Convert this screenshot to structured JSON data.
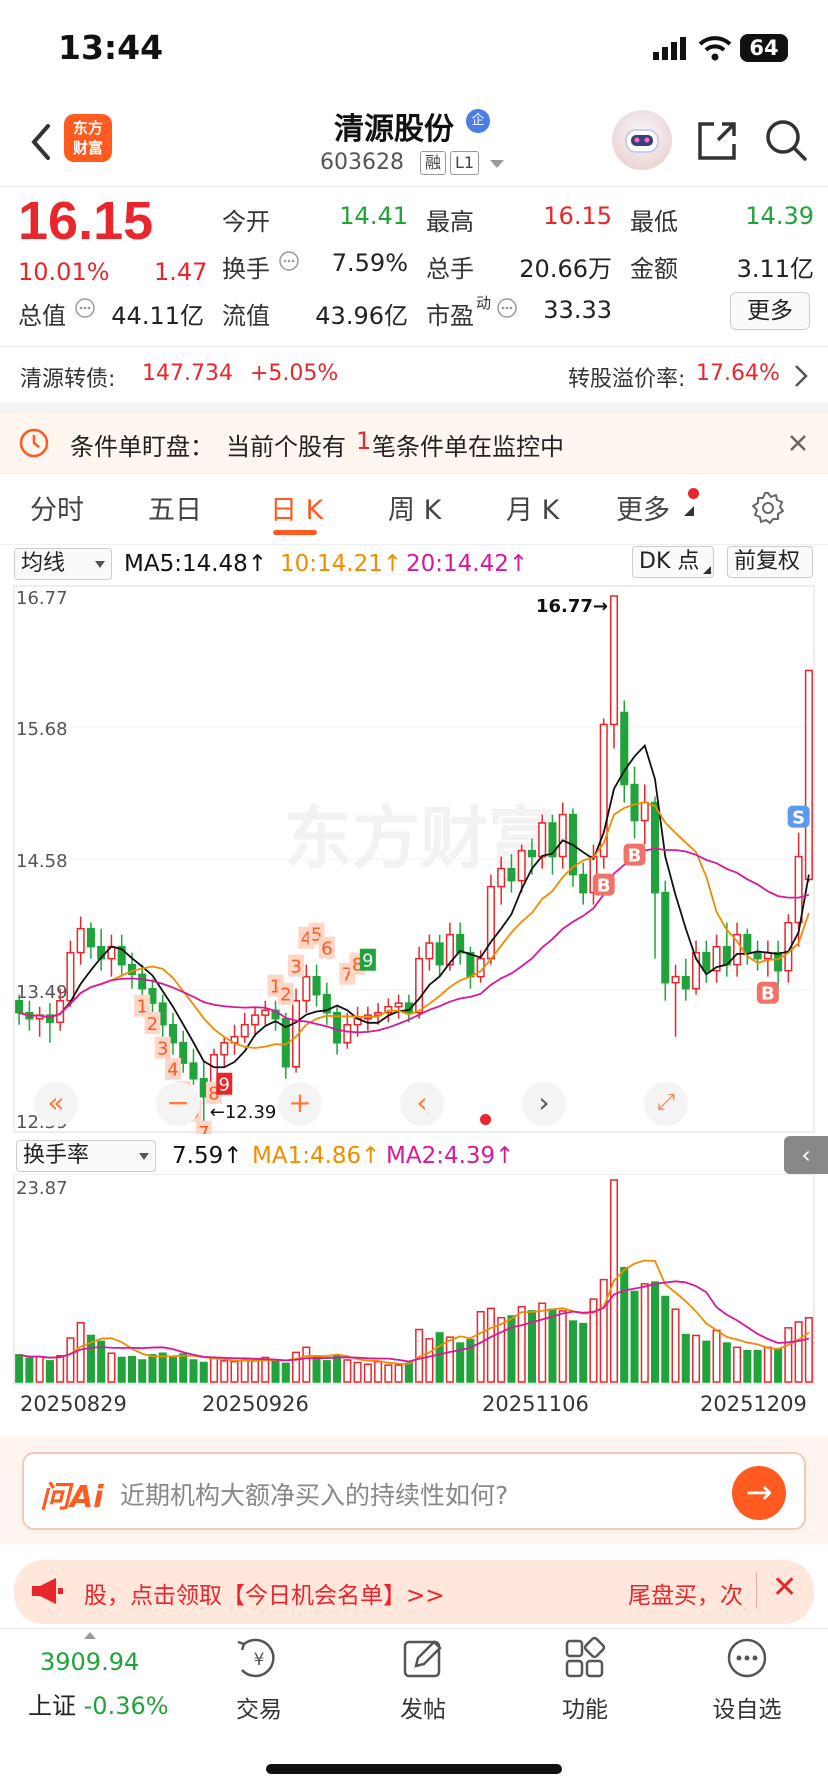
{
  "status_bar": {
    "time": "13:44",
    "battery": "64"
  },
  "header": {
    "logo": "东方\n财富",
    "stock_name": "清源股份",
    "badge": "企",
    "code": "603628",
    "tag1": "融",
    "tag2": "L1"
  },
  "quote": {
    "price": "16.15",
    "pct": "10.01%",
    "change": "1.47",
    "rows": [
      [
        {
          "label": "今开",
          "value": "14.41",
          "color": "green"
        },
        {
          "label": "最高",
          "value": "16.15",
          "color": "red"
        },
        {
          "label": "最低",
          "value": "14.39",
          "color": "green"
        }
      ],
      [
        {
          "label": "换手",
          "value": "7.59%",
          "color": "normal"
        },
        {
          "label": "总手",
          "value": "20.66万",
          "color": "normal"
        },
        {
          "label": "金额",
          "value": "3.11亿",
          "color": "normal"
        }
      ],
      [
        {
          "label": "总值",
          "value": "44.11亿",
          "color": "normal"
        },
        {
          "label": "流值",
          "value": "43.96亿",
          "color": "normal"
        },
        {
          "label": "市盈",
          "sup": "动",
          "value": "33.33",
          "color": "normal"
        }
      ]
    ],
    "more": "更多"
  },
  "convertible": {
    "label": "清源转债:",
    "price": "147.734",
    "pct": "+5.05%",
    "premium_label": "转股溢价率:",
    "premium": "17.64%"
  },
  "alert": {
    "prefix": "条件单盯盘：",
    "text_a": "当前个股有",
    "count": "1",
    "text_b": "笔条件单在监控中"
  },
  "tabs": [
    "分时",
    "五日",
    "日 K",
    "周 K",
    "月 K",
    "更多"
  ],
  "ma_bar": {
    "select": "均线",
    "ma5": "MA5:14.48",
    "ma10": "10:14.21",
    "ma20": "20:14.42",
    "dk": "DK 点",
    "fq": "前复权"
  },
  "kline": {
    "y_labels": [
      "16.77",
      "15.68",
      "14.58",
      "13.49",
      "12.39"
    ],
    "high_mark": "16.77",
    "low_mark": "12.39",
    "watermark": "东方财富",
    "seq_down": [
      "1",
      "2",
      "3",
      "4",
      "5",
      "6",
      "7",
      "8",
      "9"
    ],
    "seq_up": [
      "1",
      "2",
      "3",
      "4",
      "5",
      "6",
      "7",
      "8",
      "9"
    ],
    "b_mark": "B",
    "s_mark": "S"
  },
  "turnover": {
    "select": "换手率",
    "value": "7.59",
    "ma1": "MA1:4.86",
    "ma2": "MA2:4.39",
    "y_max": "23.87"
  },
  "dates": [
    "20250829",
    "20250926",
    "20251106",
    "20251209"
  ],
  "ai": {
    "logo": "问Ai",
    "question": "近期机构大额净买入的持续性如何?"
  },
  "promo": {
    "text": "股，点击领取【今日机会名单】>>",
    "right": "尾盘买，次"
  },
  "index": {
    "value": "3909.94",
    "name": "上证",
    "pct": "-0.36%"
  },
  "nav": [
    "交易",
    "发帖",
    "功能",
    "设自选"
  ],
  "colors": {
    "up": "#e8262c",
    "down": "#21a33c",
    "brand": "#ff5a1f",
    "ma5": "#111111",
    "ma10": "#f08c00",
    "ma20": "#d6199b"
  },
  "chart_data": {
    "type": "candlestick",
    "y_range": [
      12.39,
      16.77
    ],
    "candles": [
      [
        13.4,
        13.3,
        13.45,
        13.2
      ],
      [
        13.3,
        13.25,
        13.4,
        13.15
      ],
      [
        13.25,
        13.28,
        13.35,
        13.1
      ],
      [
        13.28,
        13.22,
        13.38,
        13.05
      ],
      [
        13.22,
        13.4,
        13.5,
        13.15
      ],
      [
        13.4,
        13.8,
        13.9,
        13.35
      ],
      [
        13.8,
        14.0,
        14.1,
        13.7
      ],
      [
        14.0,
        13.85,
        14.05,
        13.75
      ],
      [
        13.85,
        13.75,
        14.0,
        13.65
      ],
      [
        13.75,
        13.85,
        13.95,
        13.6
      ],
      [
        13.85,
        13.7,
        13.95,
        13.6
      ],
      [
        13.7,
        13.62,
        13.8,
        13.5
      ],
      [
        13.62,
        13.5,
        13.7,
        13.4
      ],
      [
        13.5,
        13.38,
        13.58,
        13.3
      ],
      [
        13.38,
        13.2,
        13.45,
        13.1
      ],
      [
        13.2,
        13.05,
        13.3,
        12.95
      ],
      [
        13.05,
        12.88,
        13.15,
        12.8
      ],
      [
        12.88,
        12.75,
        13.0,
        12.7
      ],
      [
        12.75,
        12.6,
        12.9,
        12.39
      ],
      [
        12.6,
        12.95,
        13.0,
        12.55
      ],
      [
        12.95,
        13.05,
        13.1,
        12.85
      ],
      [
        13.05,
        13.1,
        13.2,
        12.95
      ],
      [
        13.1,
        13.2,
        13.3,
        13.05
      ],
      [
        13.2,
        13.28,
        13.35,
        13.1
      ],
      [
        13.28,
        13.32,
        13.4,
        13.2
      ],
      [
        13.32,
        13.25,
        13.4,
        13.15
      ],
      [
        13.25,
        12.85,
        13.3,
        12.75
      ],
      [
        12.85,
        13.4,
        13.5,
        12.8
      ],
      [
        13.4,
        13.6,
        13.7,
        13.3
      ],
      [
        13.6,
        13.45,
        13.7,
        13.35
      ],
      [
        13.45,
        13.3,
        13.55,
        13.2
      ],
      [
        13.3,
        13.05,
        13.35,
        12.95
      ],
      [
        13.05,
        13.2,
        13.3,
        13.0
      ],
      [
        13.2,
        13.25,
        13.35,
        13.1
      ],
      [
        13.25,
        13.28,
        13.35,
        13.15
      ],
      [
        13.28,
        13.3,
        13.38,
        13.2
      ],
      [
        13.3,
        13.35,
        13.42,
        13.22
      ],
      [
        13.35,
        13.38,
        13.45,
        13.25
      ],
      [
        13.38,
        13.3,
        13.45,
        13.22
      ],
      [
        13.3,
        13.75,
        13.85,
        13.25
      ],
      [
        13.75,
        13.88,
        13.95,
        13.65
      ],
      [
        13.88,
        13.7,
        13.95,
        13.6
      ],
      [
        13.7,
        13.95,
        14.05,
        13.65
      ],
      [
        13.95,
        13.8,
        14.05,
        13.7
      ],
      [
        13.8,
        13.6,
        13.85,
        13.5
      ],
      [
        13.6,
        13.75,
        13.82,
        13.55
      ],
      [
        13.75,
        14.35,
        14.45,
        13.7
      ],
      [
        14.35,
        14.5,
        14.6,
        14.2
      ],
      [
        14.5,
        14.4,
        14.62,
        14.3
      ],
      [
        14.4,
        14.65,
        14.7,
        14.3
      ],
      [
        14.65,
        14.6,
        14.75,
        14.45
      ],
      [
        14.6,
        14.88,
        14.95,
        14.5
      ],
      [
        14.88,
        14.6,
        14.95,
        14.45
      ],
      [
        14.6,
        14.95,
        15.05,
        14.5
      ],
      [
        14.95,
        14.45,
        15.0,
        14.35
      ],
      [
        14.45,
        14.3,
        14.55,
        14.2
      ],
      [
        14.3,
        14.6,
        14.7,
        14.2
      ],
      [
        14.6,
        15.7,
        15.75,
        14.5
      ],
      [
        15.7,
        16.77,
        16.77,
        15.5
      ],
      [
        15.8,
        15.2,
        15.9,
        15.05
      ],
      [
        15.2,
        14.9,
        15.35,
        14.75
      ],
      [
        14.9,
        15.05,
        15.2,
        14.7
      ],
      [
        15.05,
        14.3,
        15.1,
        13.75
      ],
      [
        14.3,
        13.55,
        14.4,
        13.4
      ],
      [
        13.55,
        13.6,
        13.7,
        13.1
      ],
      [
        13.6,
        13.5,
        13.75,
        13.4
      ],
      [
        13.5,
        13.8,
        13.9,
        13.45
      ],
      [
        13.8,
        13.65,
        13.9,
        13.55
      ],
      [
        13.65,
        13.85,
        13.95,
        13.55
      ],
      [
        13.85,
        13.7,
        14.05,
        13.6
      ],
      [
        13.7,
        13.95,
        14.05,
        13.6
      ],
      [
        13.95,
        13.8,
        14.0,
        13.7
      ],
      [
        13.8,
        13.75,
        13.9,
        13.65
      ],
      [
        13.75,
        13.8,
        13.9,
        13.6
      ],
      [
        13.8,
        13.65,
        13.9,
        13.5
      ],
      [
        13.65,
        14.05,
        14.12,
        13.55
      ],
      [
        14.05,
        14.6,
        14.8,
        13.85
      ],
      [
        14.41,
        16.15,
        16.15,
        14.39
      ]
    ],
    "turnover": [
      3.2,
      2.8,
      3.0,
      2.5,
      3.1,
      5.2,
      7.0,
      5.5,
      4.8,
      3.4,
      2.9,
      3.0,
      2.6,
      3.2,
      3.4,
      3.0,
      3.3,
      2.6,
      2.3,
      2.8,
      2.5,
      2.4,
      2.6,
      2.5,
      2.9,
      2.6,
      2.2,
      3.5,
      4.1,
      3.0,
      2.5,
      3.1,
      2.6,
      2.3,
      2.1,
      2.4,
      2.0,
      2.0,
      2.2,
      6.2,
      5.1,
      5.8,
      5.3,
      4.6,
      5.0,
      8.3,
      8.7,
      7.6,
      7.8,
      8.9,
      8.4,
      9.3,
      8.6,
      8.4,
      7.2,
      6.9,
      9.8,
      12.1,
      23.87,
      13.5,
      10.7,
      11.6,
      11.8,
      10.1,
      8.6,
      5.6,
      5.5,
      4.8,
      6.1,
      4.6,
      4.1,
      3.7,
      3.7,
      4.1,
      3.9,
      6.4,
      7.1,
      7.59
    ]
  }
}
